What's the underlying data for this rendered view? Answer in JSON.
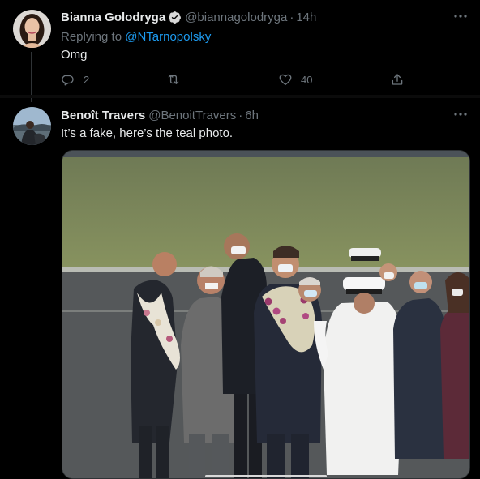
{
  "tweets": [
    {
      "display_name": "Bianna Golodryga",
      "handle": "@biannagolodryga",
      "separator": "·",
      "time": "14h",
      "verified": true,
      "replying_prefix": "Replying to",
      "replying_to": "@NTarnopolsky",
      "text": "Omg",
      "reply_count": "2",
      "retweet_count": "",
      "like_count": "40"
    },
    {
      "display_name": "Benoît Travers",
      "handle": "@BenoitTravers",
      "separator": "·",
      "time": "6h",
      "text": "It’s a fake, here’s the teal photo."
    }
  ],
  "icons": {
    "verified": "verified-badge-icon",
    "more": "more-icon",
    "reply": "reply-icon",
    "retweet": "retweet-icon",
    "like": "like-icon",
    "share": "share-icon"
  },
  "colors": {
    "background": "#000000",
    "text_primary": "#e7e9ea",
    "text_secondary": "#6e767d",
    "accent": "#1d9bf0"
  }
}
